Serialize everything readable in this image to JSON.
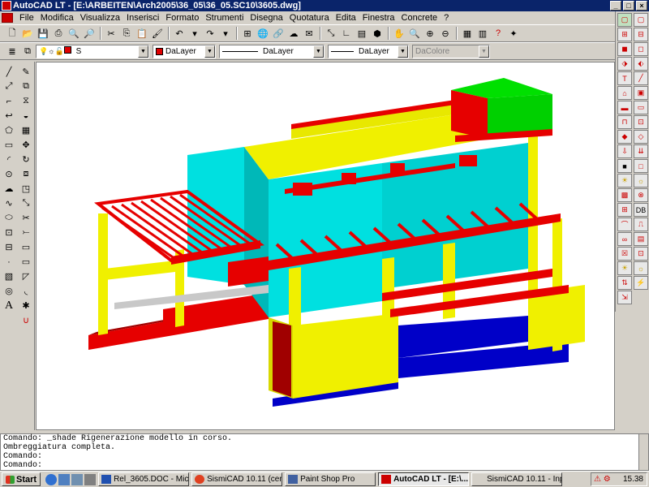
{
  "window": {
    "title": "AutoCAD LT - [E:\\ARBEITEN\\Arch2005\\36_05\\36_05.SC10\\3605.dwg]"
  },
  "menu": [
    "File",
    "Modifica",
    "Visualizza",
    "Inserisci",
    "Formato",
    "Strumenti",
    "Disegna",
    "Quotatura",
    "Edita",
    "Finestra",
    "Concrete",
    "?"
  ],
  "toolbar": {
    "layer_name": "S",
    "color_combo": "DaLayer",
    "linetype_combo": "DaLayer",
    "lineweight_combo": "DaLayer",
    "plotstyle_combo": "DaColore",
    "colors": {
      "accent_red": "#e00000"
    }
  },
  "command": {
    "lines": [
      "Comando: _shade Rigenerazione modello in corso.",
      "Ombreggiatura completa.",
      "Comando:",
      "Comando:"
    ]
  },
  "taskbar": {
    "start": "Start",
    "tasks": [
      "Rel_3605.DOC - Micros...",
      "SismiCAD 10.11 (ceme...",
      "Paint Shop Pro",
      "AutoCAD LT - [E:\\...",
      "SismiCAD 10.11 - Input da..."
    ],
    "clock": "15.38"
  },
  "colors": {
    "model_red": "#e60000",
    "model_yellow": "#f0f000",
    "model_cyan": "#00e0e0",
    "model_blue": "#0000c8",
    "model_green": "#00d000",
    "model_darkred": "#a00000",
    "title_blue": "#0a246a"
  }
}
